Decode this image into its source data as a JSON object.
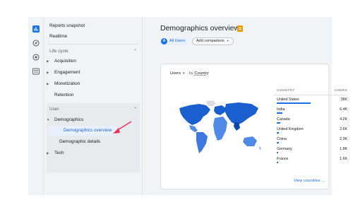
{
  "nav": {
    "items": [
      {
        "label": "Reports snapshot"
      },
      {
        "label": "Realtime"
      }
    ],
    "life_cycle": {
      "heading": "Life cycle",
      "items": [
        {
          "label": "Acquisition"
        },
        {
          "label": "Engagement"
        },
        {
          "label": "Monetization"
        },
        {
          "label": "Retention"
        }
      ]
    },
    "user": {
      "heading": "User",
      "demographics": "Demographics",
      "demographics_overview": "Demographics overview",
      "demographic_details": "Demographic details",
      "tech": "Tech"
    }
  },
  "header": {
    "title": "Demographics overview"
  },
  "chips": {
    "badge": "A",
    "all_users": "All Users",
    "add_comparison": "Add comparison"
  },
  "card": {
    "metric": "Users",
    "by": "by",
    "dimension": "Country",
    "table": {
      "col_country": "COUNTRY",
      "col_users": "USERS",
      "rows": [
        {
          "country": "United States",
          "users": "38K",
          "share": 1.0
        },
        {
          "country": "India",
          "users": "6.4K",
          "share": 0.168
        },
        {
          "country": "Canada",
          "users": "4.2K",
          "share": 0.11
        },
        {
          "country": "United Kingdom",
          "users": "2.6K",
          "share": 0.068
        },
        {
          "country": "China",
          "users": "2.3K",
          "share": 0.06
        },
        {
          "country": "Germany",
          "users": "1.8K",
          "share": 0.047
        },
        {
          "country": "France",
          "users": "1.6K",
          "share": 0.042
        }
      ]
    },
    "view_link": "View countries"
  },
  "colors": {
    "accent": "#1a73e8",
    "map_dark": "#1a5fd0",
    "map_light": "#8ab4f8",
    "annotation_arrow": "#e8335a"
  }
}
